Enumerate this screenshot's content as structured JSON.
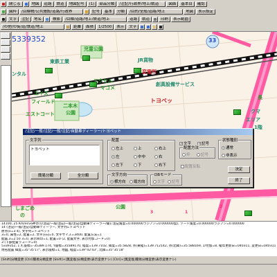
{
  "toolbar": {
    "row1": [
      "閉じる",
      "地図",
      "道路",
      "鉄道",
      "地図記号",
      "(1)",
      "部品分類",
      "/注記/行政界/地上/軌道",
      "図面",
      "基本目",
      "確認"
    ],
    "row2": [
      "図枠",
      "/目標物/公共施設/道路/行政界",
      "記号",
      "基本",
      "分類",
      "/目的/全般/道路/地上",
      "地図",
      "表示設定"
    ],
    "row3": [
      "文字",
      "注記",
      "地名",
      "検索",
      "/目標/道路/地上/鉄道/地上",
      "道路",
      "軌道",
      "印刷",
      "表示範囲"
    ],
    "row4": [
      "/の他/の街/道/鉄道/地上",
      "距離",
      "面積",
      "1/2500",
      "表示",
      "文字"
    ]
  },
  "map": {
    "number": "5339352",
    "badge": "33",
    "labels": [
      "児童公園",
      "東鉄工業",
      "JR貨物",
      "変電所",
      "エクセル",
      "マゴメ",
      "創真設備サービス",
      "トヨペッ",
      "エイス",
      "フィールド",
      "二本木",
      "公園",
      "エストコート",
      "クマ",
      "エリア",
      "長",
      "1階",
      "しまごめ",
      "の",
      "ンタル",
      "公園"
    ],
    "route_numbers": [
      "3",
      "5",
      "3",
      "3",
      "1"
    ]
  },
  "dialog": {
    "title": "/注記/一般/注記/一般/注記/自動車ディーラー/トヨペット",
    "text_group_label": "文字列",
    "text_value": "トヨペット",
    "placement_label": "配置",
    "placement": [
      "左上",
      "上",
      "右上",
      "左",
      "中中",
      "右",
      "左下",
      "下",
      "右下"
    ],
    "placement_selected": "左",
    "direction_label": "文字方向",
    "direction": [
      "横方向",
      "縦方向"
    ],
    "direction_selected": "横方向",
    "db_mode_label": "DBモード",
    "db_mode": [
      "文字",
      "記号"
    ],
    "options_label": "配置方法",
    "checks": [
      {
        "label": "文字",
        "checked": true
      },
      {
        "label": "記号",
        "checked": true
      }
    ],
    "disabled_options": [
      "枠",
      "記号"
    ],
    "check3": "配置反転",
    "state_label": "状態種別",
    "state": [
      "通常",
      "非表示"
    ],
    "state_selected": "通常",
    "buttons": {
      "simple": "簡易分類",
      "all": "全分類",
      "ok": "決定",
      "close": "終了"
    }
  },
  "status_lines": [
    "14100, 25 Km/ecvo神奈川/注記/一般/注記/一般/注記/自動車ディーラー/書1:注記角度=0.000000ラジアン=0.000000度), ソート角度=0.000000ラジアン=0.000000",
    "14 (注記)一般/注記/自動車ディーラー, 文字列=トヨペット",
    "原点(x=3 4), 文字列=トヨペット",
    "3=0, 属性=2, 配置=2, 文字方向=0, 文字サイズ=3400, 配置方法=1",
    "配置,3=2.50 3=0, 表示目印=1, 配置=0 (2, 配置文字, 表示付加コード=0)",
    "3 (下部配置ラコード=0)",
    "5339352, 1 X 座標=-35389.174, Y座標=35589170, 経度=139.7102, 緯度=35.5828, 点(東経)=139.712142, 点(北緯)=35.588169, 1/付加=8, 縦年更新日=040311, 変更日=040311",
    "地名配置 緯度=35°35'17\", 表示座標=1, 地図, 経度=139°42'43\", 北緯=35°35'18\""
  ],
  "fkeys": "[Shift]分類変更 [Ctrl]簡易分類変更 [Shift]+[無変換]分類変更(表示変更ナシ) [Ctrl]+[無変換]簡易分類変更(表示変更ナシ)",
  "colors": {
    "map_bg": "#fbf2e7",
    "road_pink": "#ff5aa2",
    "rail": "#1c1c1c",
    "green_label": "#2d9a2d",
    "teal_label": "#1f8a6e",
    "red_label": "#c4262e",
    "dialog_title_start": "#0a246a",
    "dialog_title_end": "#a6caf0"
  }
}
